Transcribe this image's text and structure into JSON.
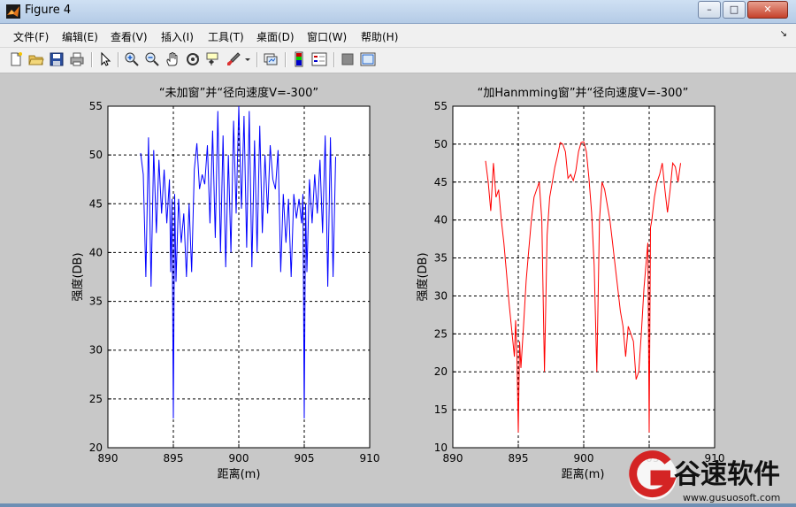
{
  "window": {
    "title": "Figure 4",
    "controls": {
      "minimize": "–",
      "maximize": "□",
      "close": "✕"
    }
  },
  "menubar": {
    "items": [
      "文件(F)",
      "编辑(E)",
      "查看(V)",
      "插入(I)",
      "工具(T)",
      "桌面(D)",
      "窗口(W)",
      "帮助(H)"
    ],
    "overflow": "↘"
  },
  "toolbar": {
    "icons": [
      "new-figure-icon",
      "open-file-icon",
      "save-icon",
      "print-icon",
      "pointer-icon",
      "zoom-in-icon",
      "zoom-out-icon",
      "pan-hand-icon",
      "rotate-3d-icon",
      "data-cursor-icon",
      "brush-icon",
      "brush-dropdown-icon",
      "link-plot-icon",
      "colorbar-icon",
      "legend-icon",
      "hide-plot-tools-icon",
      "show-plot-tools-icon"
    ]
  },
  "watermark": {
    "brand": "谷速软件",
    "url": "www.gusuosoft.com"
  },
  "chart_data": [
    {
      "type": "line",
      "title": "“未加窗”并“径向速度V=-300”",
      "xlabel": "距离(m)",
      "ylabel": "强度(DB)",
      "xlim": [
        890,
        910
      ],
      "ylim": [
        20,
        55
      ],
      "xticks": [
        890,
        895,
        900,
        905,
        910
      ],
      "yticks": [
        20,
        25,
        30,
        35,
        40,
        45,
        50,
        55
      ],
      "grid": true,
      "color": "#0000ff",
      "x": [
        892.5,
        892.7,
        892.9,
        893.1,
        893.3,
        893.5,
        893.7,
        893.9,
        894.1,
        894.3,
        894.5,
        894.7,
        894.8,
        894.9,
        895.0,
        895.1,
        895.2,
        895.4,
        895.6,
        895.8,
        896.0,
        896.2,
        896.4,
        896.6,
        896.8,
        897.0,
        897.2,
        897.4,
        897.6,
        897.8,
        898.0,
        898.2,
        898.4,
        898.6,
        898.8,
        899.0,
        899.2,
        899.4,
        899.6,
        899.8,
        900.0,
        900.2,
        900.4,
        900.6,
        900.8,
        901.0,
        901.2,
        901.4,
        901.6,
        901.8,
        902.0,
        902.2,
        902.4,
        902.6,
        902.8,
        903.0,
        903.2,
        903.4,
        903.6,
        903.8,
        904.0,
        904.2,
        904.4,
        904.6,
        904.8,
        904.9,
        905.0,
        905.1,
        905.2,
        905.4,
        905.6,
        905.8,
        906.0,
        906.2,
        906.4,
        906.6,
        906.8,
        907.0,
        907.2,
        907.4
      ],
      "y": [
        50.2,
        48.0,
        37.5,
        51.8,
        36.5,
        50.5,
        42.0,
        49.5,
        44.0,
        48.5,
        43.0,
        47.5,
        38.0,
        45.5,
        23.0,
        46.0,
        37.0,
        45.5,
        41.0,
        44.0,
        37.5,
        45.0,
        38.0,
        48.5,
        51.2,
        46.5,
        48.0,
        47.0,
        51.0,
        43.0,
        52.5,
        41.5,
        54.5,
        40.0,
        52.0,
        38.5,
        50.0,
        40.0,
        53.5,
        44.0,
        55.0,
        44.5,
        54.0,
        40.5,
        54.5,
        38.5,
        51.5,
        40.0,
        53.0,
        42.0,
        50.0,
        44.0,
        51.0,
        47.5,
        46.5,
        50.5,
        38.0,
        46.0,
        41.0,
        45.5,
        37.5,
        46.0,
        43.5,
        45.5,
        43.0,
        46.0,
        23.0,
        45.0,
        38.0,
        47.5,
        43.0,
        48.0,
        44.0,
        49.5,
        42.0,
        52.0,
        36.5,
        51.8,
        37.5,
        49.8
      ]
    },
    {
      "type": "line",
      "title": "“加Hanmming窗”并“径向速度V=-300”",
      "xlabel": "距离(m)",
      "ylabel": "强度(DB)",
      "xlim": [
        890,
        910
      ],
      "ylim": [
        10,
        55
      ],
      "xticks": [
        890,
        895,
        900,
        905,
        910
      ],
      "yticks": [
        10,
        15,
        20,
        25,
        30,
        35,
        40,
        45,
        50,
        55
      ],
      "grid": true,
      "color": "#ff0000",
      "x": [
        892.5,
        892.7,
        892.9,
        893.1,
        893.3,
        893.5,
        893.7,
        893.9,
        894.1,
        894.3,
        894.5,
        894.7,
        894.8,
        894.9,
        895.0,
        895.1,
        895.2,
        895.4,
        895.6,
        895.8,
        896.0,
        896.2,
        896.4,
        896.6,
        896.8,
        897.0,
        897.2,
        897.4,
        897.6,
        897.8,
        898.0,
        898.2,
        898.4,
        898.6,
        898.8,
        899.0,
        899.2,
        899.4,
        899.6,
        899.8,
        900.0,
        900.2,
        900.4,
        900.6,
        900.8,
        901.0,
        901.2,
        901.4,
        901.6,
        901.8,
        902.0,
        902.2,
        902.4,
        902.6,
        902.8,
        903.0,
        903.2,
        903.4,
        903.6,
        903.8,
        904.0,
        904.2,
        904.4,
        904.6,
        904.8,
        904.9,
        905.0,
        905.1,
        905.2,
        905.4,
        905.6,
        905.8,
        906.0,
        906.2,
        906.4,
        906.6,
        906.8,
        907.0,
        907.2,
        907.4
      ],
      "y": [
        47.8,
        45.0,
        41.2,
        47.5,
        43.0,
        44.0,
        40.0,
        37.0,
        33.0,
        29.0,
        25.5,
        22.0,
        26.8,
        22.0,
        12.0,
        24.0,
        20.5,
        26.0,
        32.0,
        36.0,
        40.0,
        43.0,
        44.0,
        45.0,
        40.0,
        20.0,
        38.0,
        43.0,
        45.0,
        47.0,
        48.5,
        50.2,
        50.0,
        49.0,
        45.5,
        46.0,
        45.2,
        46.5,
        49.0,
        50.2,
        50.3,
        49.0,
        45.5,
        41.0,
        34.0,
        20.0,
        40.0,
        45.0,
        44.0,
        42.0,
        40.0,
        37.0,
        34.0,
        31.0,
        28.0,
        26.0,
        22.0,
        26.0,
        25.0,
        24.0,
        19.0,
        20.0,
        25.0,
        31.0,
        35.0,
        37.0,
        12.0,
        39.0,
        40.0,
        43.0,
        45.0,
        46.0,
        47.5,
        44.0,
        41.0,
        44.0,
        47.5,
        47.0,
        45.0,
        47.5
      ]
    }
  ]
}
